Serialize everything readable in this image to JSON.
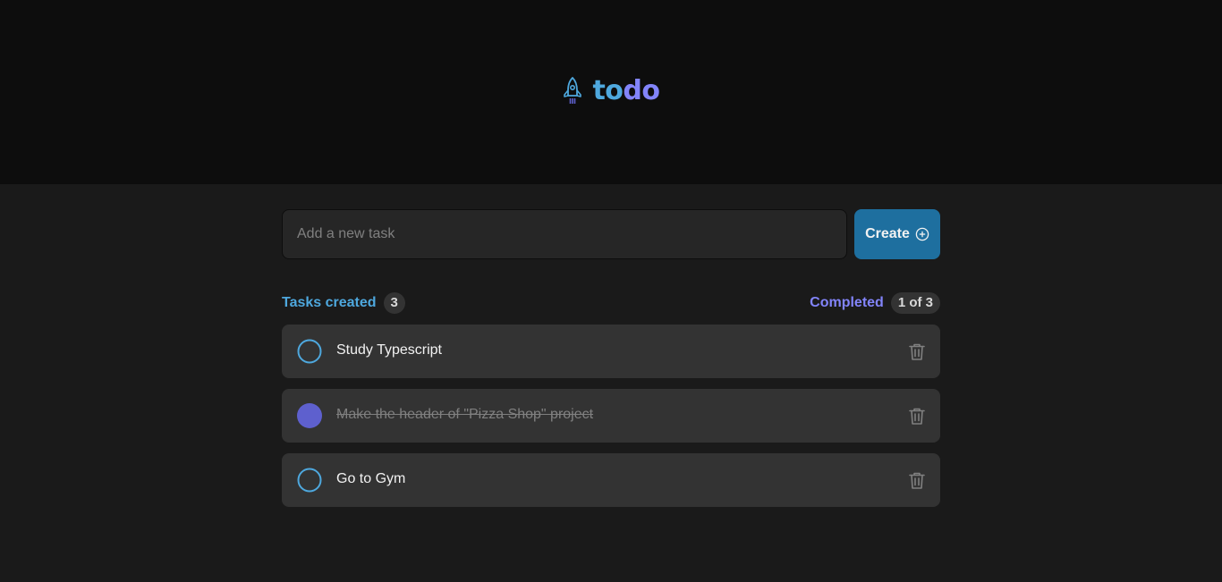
{
  "header": {
    "logo_icon": "rocket-icon",
    "logo_part1": "to",
    "logo_part2": "do"
  },
  "new_task": {
    "placeholder": "Add a new task",
    "value": "",
    "create_label": "Create",
    "create_icon": "plus-circle-icon"
  },
  "counters": {
    "created_label": "Tasks created",
    "created_count": "3",
    "completed_label": "Completed",
    "completed_count": "1 of 3"
  },
  "tasks": [
    {
      "text": "Study Typescript",
      "completed": false
    },
    {
      "text": "Make the header of \"Pizza Shop\" project",
      "completed": true
    },
    {
      "text": "Go to Gym",
      "completed": false
    }
  ],
  "colors": {
    "blue": "#4ea8de",
    "blue_dark": "#1e6f9f",
    "purple": "#8284fa",
    "purple_dark": "#5e60ce",
    "header_bg": "#0d0d0d",
    "body_bg": "#1a1a1a",
    "card_bg": "#333333"
  }
}
